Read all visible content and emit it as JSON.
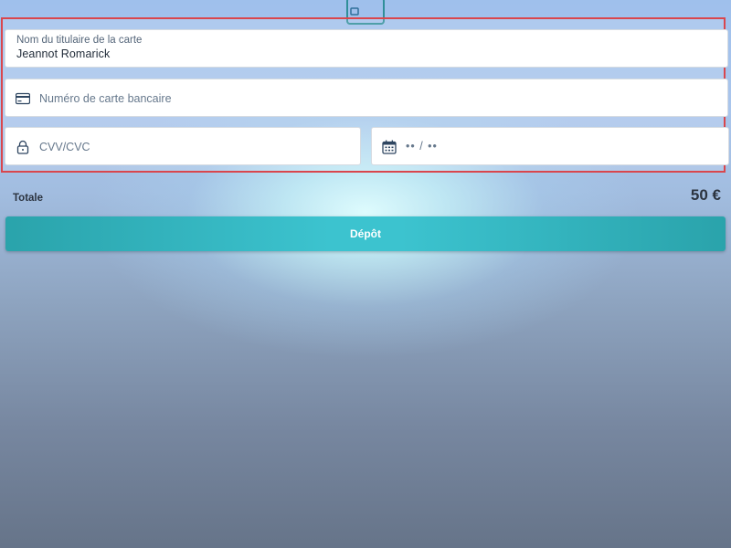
{
  "header": {
    "card_icon": "credit-card-icon"
  },
  "form": {
    "cardholder": {
      "label": "Nom du titulaire de la carte",
      "value": "Jeannot Romarick"
    },
    "card_number": {
      "icon": "credit-card-icon",
      "placeholder": "Numéro de carte bancaire"
    },
    "cvv": {
      "icon": "lock-icon",
      "placeholder": "CVV/CVC"
    },
    "expiry": {
      "icon": "calendar-icon",
      "placeholder": "•• / ••"
    }
  },
  "summary": {
    "total_label": "Totale",
    "total_amount": "50 €"
  },
  "actions": {
    "deposit_label": "Dépôt"
  },
  "colors": {
    "accent": "#3cc3cf",
    "highlight_border": "#d9464d"
  }
}
